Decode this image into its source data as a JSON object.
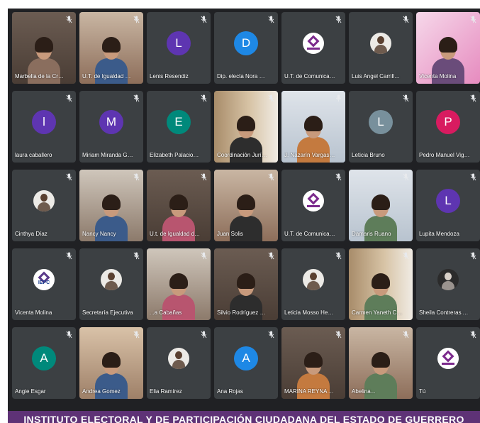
{
  "colors": {
    "tile_background": "#3c4043",
    "stage_background": "#202124",
    "banner_background": "#5e3276",
    "active_speaker_border": "#8ab4f8"
  },
  "banner_text": "INSTITUTO ELECTORAL Y DE PARTICIPACIÓN CIUDADANA DEL ESTADO DE GUERRERO",
  "tiles": [
    {
      "name": "Marbella de la Cruz santi...",
      "kind": "video",
      "muted": true
    },
    {
      "name": "U.T. de Igualdad de Gén...",
      "kind": "video",
      "muted": true
    },
    {
      "name": "Lenis Resendiz",
      "kind": "initial",
      "initial": "L",
      "avatar_color": "#5e35b1",
      "muted": true
    },
    {
      "name": "Dip. electa Nora Velázquez",
      "kind": "initial",
      "initial": "D",
      "avatar_color": "#1e88e5",
      "muted": true
    },
    {
      "name": "U.T. de Comunicación So...",
      "kind": "logo",
      "logo": "ut-comunicacion-logo",
      "muted": true
    },
    {
      "name": "Luis Angel Carrillo Contre...",
      "kind": "photo",
      "muted": true
    },
    {
      "name": "Vicenta Molina",
      "kind": "video",
      "muted": true
    },
    {
      "name": "laura caballero",
      "kind": "initial",
      "initial": "l",
      "avatar_color": "#5e35b1",
      "muted": true
    },
    {
      "name": "Miriam Miranda García",
      "kind": "initial",
      "initial": "M",
      "avatar_color": "#5e35b1",
      "muted": true
    },
    {
      "name": "Elizabeth Palacios Rodríg...",
      "kind": "initial",
      "initial": "E",
      "avatar_color": "#00897b",
      "muted": true
    },
    {
      "name": "Coordinación Jurídica...",
      "kind": "video",
      "muted": true
    },
    {
      "name": "J. Nazarín Vargas Arme...",
      "kind": "video",
      "muted": false,
      "speaking": true
    },
    {
      "name": "Leticia Bruno",
      "kind": "initial",
      "initial": "L",
      "avatar_color": "#78909c",
      "muted": true
    },
    {
      "name": "Pedro Manuel Vigueras E...",
      "kind": "initial",
      "initial": "P",
      "avatar_color": "#d81b60",
      "muted": true
    },
    {
      "name": "Cinthya Díaz",
      "kind": "photo",
      "muted": true
    },
    {
      "name": "Nancy Nancy",
      "kind": "video",
      "muted": true
    },
    {
      "name": "U.t. de Igualdad de Géne...",
      "kind": "video",
      "muted": true
    },
    {
      "name": "Juan Solis",
      "kind": "video",
      "muted": true
    },
    {
      "name": "U.T. de Comunicación So...",
      "kind": "logo",
      "logo": "ut-comunicacion-logo",
      "muted": true
    },
    {
      "name": "Damaris Ruano",
      "kind": "video",
      "muted": true
    },
    {
      "name": "Lupita Mendoza",
      "kind": "initial",
      "initial": "L",
      "avatar_color": "#5e35b1",
      "muted": true
    },
    {
      "name": "Vicenta Molina",
      "kind": "logo",
      "logo": "iepc-logo",
      "logo_text": "IEPC",
      "muted": true
    },
    {
      "name": "Secretaría Ejecutiva",
      "kind": "photo",
      "muted": true
    },
    {
      "name": "...a Cabañas",
      "kind": "video",
      "muted": true
    },
    {
      "name": "Silvio Rodríguez García",
      "kind": "video",
      "muted": true
    },
    {
      "name": "Leticia Mosso Hernández",
      "kind": "photo",
      "muted": true
    },
    {
      "name": "Carmen Yaneth Castil...",
      "kind": "video",
      "muted": true
    },
    {
      "name": "Sheila Contreras Alcaraz",
      "kind": "photo",
      "dark": true,
      "muted": true
    },
    {
      "name": "Angie Esgar",
      "kind": "initial",
      "initial": "A",
      "avatar_color": "#00897b",
      "muted": true
    },
    {
      "name": "Andrea Gomez",
      "kind": "video",
      "muted": true
    },
    {
      "name": "Elia Ramírez",
      "kind": "photo",
      "muted": true
    },
    {
      "name": "Ana Rojas",
      "kind": "initial",
      "initial": "A",
      "avatar_color": "#1e88e5",
      "muted": true
    },
    {
      "name": "MARINA REYNA AGUILAR",
      "kind": "video",
      "muted": true
    },
    {
      "name": "Abelina...",
      "kind": "video",
      "muted": true
    },
    {
      "name": "Tú",
      "kind": "logo",
      "logo": "ut-comunicacion-logo",
      "muted": true
    }
  ]
}
